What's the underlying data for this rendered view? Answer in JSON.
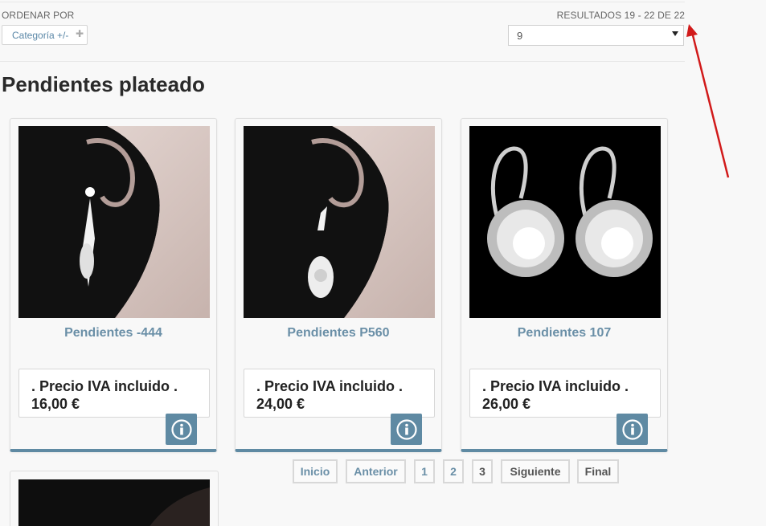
{
  "toolbar": {
    "sort_label": "ORDENAR POR",
    "sort_button_label": "Categoría +/-",
    "sort_button_icon": "plus-icon",
    "results_text": "RESULTADOS 19 - 22 DE 22",
    "limit_value": "9"
  },
  "category": {
    "title": "Pendientes plateado"
  },
  "products": [
    {
      "name": "Pendientes -444",
      "price_label": ". Precio IVA incluido .",
      "price": "16,00 €",
      "info_icon": "info-icon"
    },
    {
      "name": "Pendientes P560",
      "price_label": ". Precio IVA incluido .",
      "price": "24,00 €",
      "info_icon": "info-icon"
    },
    {
      "name": "Pendientes 107",
      "price_label": ". Precio IVA incluido .",
      "price": "26,00 €",
      "info_icon": "info-icon"
    }
  ],
  "pagination": {
    "first": "Inicio",
    "prev": "Anterior",
    "pages": [
      "1",
      "2",
      "3"
    ],
    "next": "Siguiente",
    "last": "Final"
  },
  "colors": {
    "accent": "#5f8aa3",
    "link": "#6a8fa7",
    "annotation_arrow": "#d11a1a"
  }
}
